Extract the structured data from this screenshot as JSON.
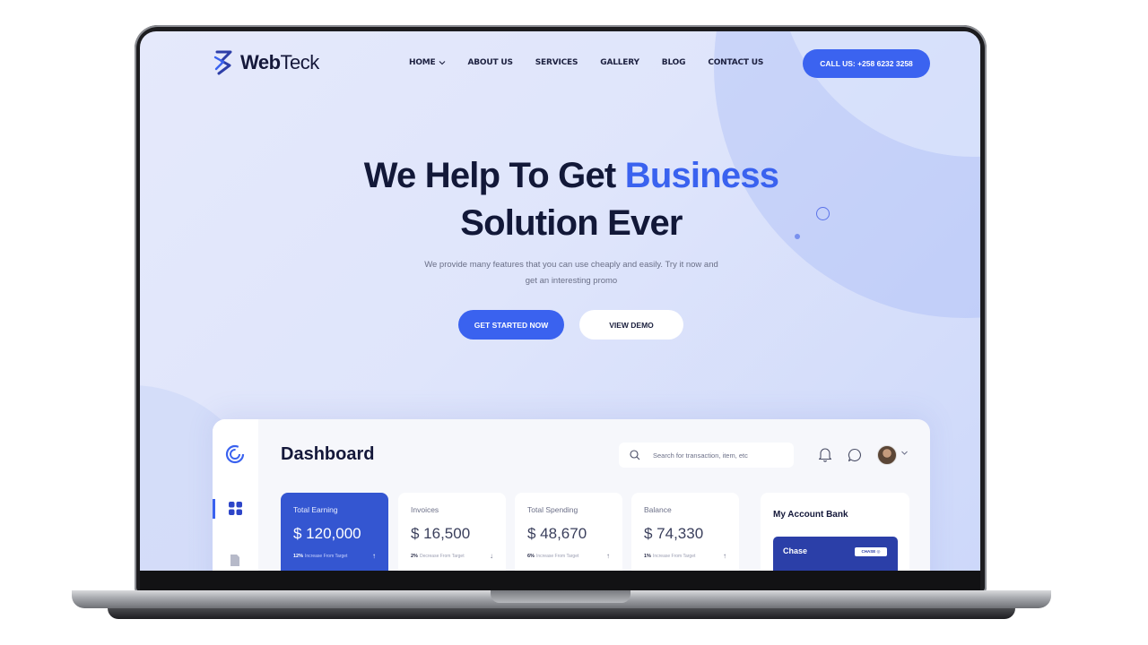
{
  "brand": {
    "name_bold": "Web",
    "name_light": "Teck"
  },
  "nav": {
    "items": [
      "HOME",
      "ABOUT US",
      "SERVICES",
      "GALLERY",
      "BLOG",
      "CONTACT US"
    ],
    "call_label": "CALL US: +258 6232 3258"
  },
  "hero": {
    "title_line1_a": "We Help To Get ",
    "title_line1_b": "Business",
    "title_line2": "Solution Ever",
    "subtitle_line1": "We provide many features that you can use cheaply and easily. Try it now and",
    "subtitle_line2": "get an interesting promo",
    "primary_cta": "GET STARTED NOW",
    "secondary_cta": "VIEW DEMO"
  },
  "dashboard": {
    "title": "Dashboard",
    "search_placeholder": "Search for transaction, item, etc",
    "cards": [
      {
        "label": "Total Earning",
        "value": "$ 120,000",
        "pct": "12%",
        "note": "Increase From Target",
        "arrow": "↑"
      },
      {
        "label": "Invoices",
        "value": "$ 16,500",
        "pct": "2%",
        "note": "Decrease From Target",
        "arrow": "↓"
      },
      {
        "label": "Total Spending",
        "value": "$ 48,670",
        "pct": "6%",
        "note": "Increase From Target",
        "arrow": "↑"
      },
      {
        "label": "Balance",
        "value": "$ 74,330",
        "pct": "1%",
        "note": "Increase From Target",
        "arrow": "↑"
      }
    ],
    "bank": {
      "title": "My Account Bank",
      "card_name": "Chase",
      "card_logo": "CHASE ◎"
    }
  },
  "colors": {
    "accent": "#3a62ef",
    "dark": "#121838",
    "card_active": "#3456d1",
    "bank_card": "#2b3fa8"
  }
}
